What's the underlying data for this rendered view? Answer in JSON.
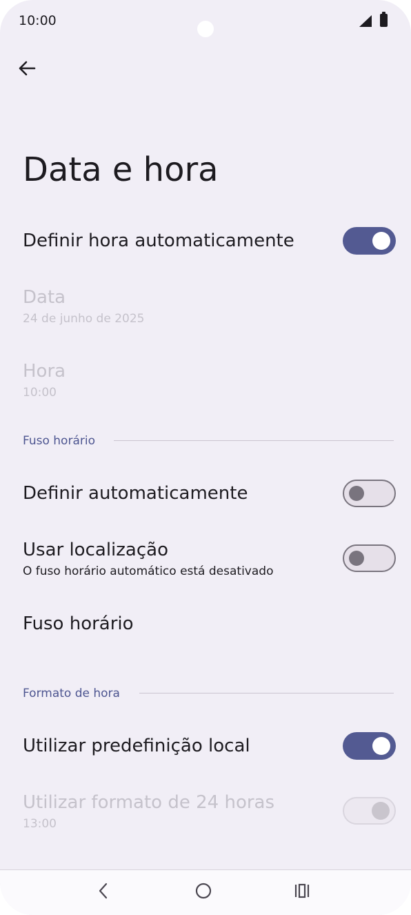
{
  "status_bar": {
    "time": "10:00"
  },
  "header": {
    "title": "Data e hora"
  },
  "items": {
    "auto_time": {
      "label": "Definir hora automaticamente",
      "state": "on"
    },
    "date": {
      "label": "Data",
      "value": "24 de junho de 2025"
    },
    "time": {
      "label": "Hora",
      "value": "10:00"
    }
  },
  "timezone_section": {
    "label": "Fuso horário",
    "auto_set": {
      "label": "Definir automaticamente",
      "state": "off"
    },
    "use_location": {
      "label": "Usar localização",
      "summary": "O fuso horário automático está desativado",
      "state": "off"
    },
    "timezone": {
      "label": "Fuso horário"
    }
  },
  "time_format_section": {
    "label": "Formato de hora",
    "use_locale": {
      "label": "Utilizar predefinição local",
      "state": "on"
    },
    "use_24h": {
      "label": "Utilizar formato de 24 horas",
      "value": "13:00",
      "state": "on-disabled"
    }
  },
  "colors": {
    "background": "#f1eef6",
    "accent": "#535a92",
    "section_label": "#4d5590",
    "disabled_text": "#c5c2cb"
  },
  "icons": {
    "back": "back-arrow-icon",
    "nav_back": "nav-back-icon",
    "nav_home": "nav-home-icon",
    "nav_recents": "nav-recents-icon"
  }
}
